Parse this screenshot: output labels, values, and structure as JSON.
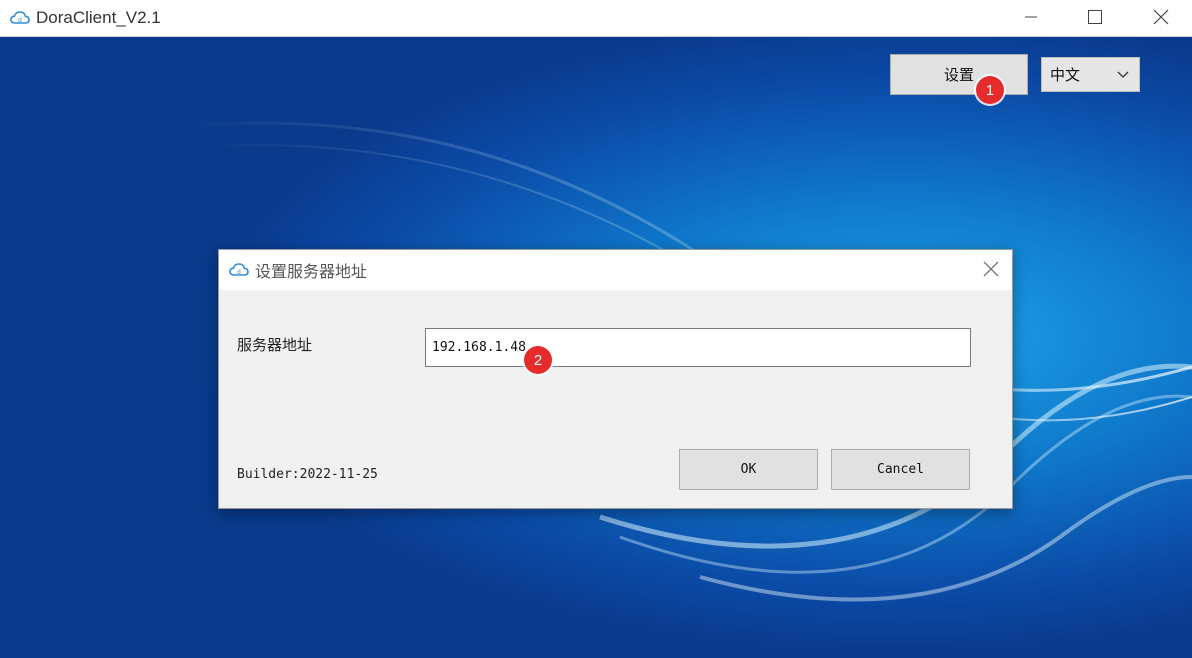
{
  "window": {
    "title": "DoraClient_V2.1",
    "controls": [
      "minimize-icon",
      "maximize-icon",
      "close-icon"
    ]
  },
  "toolbar": {
    "settings_label": "设置",
    "language_selected": "中文"
  },
  "markers": {
    "one": "1",
    "two": "2"
  },
  "dialog": {
    "title": "设置服务器地址",
    "field_label": "服务器地址",
    "server_address": "192.168.1.48",
    "ok_label": "OK",
    "cancel_label": "Cancel",
    "builder": "Builder:2022-11-25"
  },
  "colors": {
    "marker": "#e52b2b",
    "background_blue": "#0f76c9",
    "app_icon": "#2e8fd6"
  }
}
